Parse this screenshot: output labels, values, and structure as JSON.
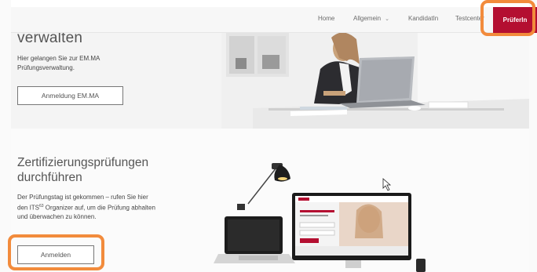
{
  "nav": {
    "items": [
      {
        "label": "Home"
      },
      {
        "label": "Allgemein"
      },
      {
        "label": "KandidatIn"
      },
      {
        "label": "Testcenter"
      },
      {
        "label": "PrüferIn"
      }
    ],
    "allgemein_chevron": "chevron-down-icon",
    "active_color": "#b40f31"
  },
  "section1": {
    "title": "verwalten",
    "text": "Hier gelangen Sie zur EM.MA Prüfungsverwaltung.",
    "button_label": "Anmeldung EM.MA"
  },
  "section2": {
    "title_line1": "Zertifizierungsprüfungen",
    "title_line2": "durchführen",
    "text_before": "Der Prüfungstag ist gekommen – rufen Sie hier den ITS",
    "text_sup": "63",
    "text_after": " Organizer auf, um die Prüfung abhalten und überwachen zu können.",
    "button_label": "Anmelden"
  },
  "highlight_color": "#f28b3c"
}
